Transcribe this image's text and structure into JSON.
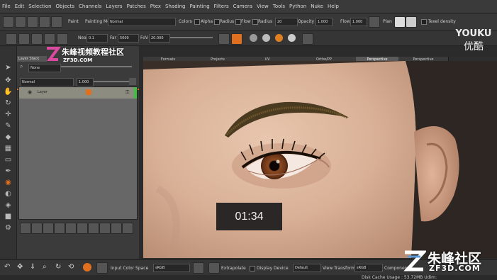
{
  "menu": [
    "File",
    "Edit",
    "Selection",
    "Objects",
    "Channels",
    "Layers",
    "Patches",
    "Ptex",
    "Shading",
    "Painting",
    "Filters",
    "Camera",
    "View",
    "Tools",
    "Python",
    "Nuke",
    "Help"
  ],
  "toolbar1": {
    "paint_label": "Paint",
    "painting_mode_label": "Painting Mode",
    "painting_mode_value": "Normal",
    "colors_label": "Colors",
    "alpha_label": "Alpha",
    "radius_label": "Radius",
    "flow_label": "Flow",
    "radius2_label": "Radius",
    "radius_value": "20",
    "opacity_label": "Opacity",
    "opacity_value": "1.000",
    "flow2_label": "Flow",
    "flow_value": "1.000",
    "plan_label": "Plan",
    "texel_density_label": "Texel density"
  },
  "toolbar2": {
    "near_label": "Near",
    "near_value": "0.1",
    "far_label": "Far",
    "far_value": "5000",
    "fov_label": "FoV",
    "fov_value": "20.000"
  },
  "layers_panel": {
    "tab_label": "Layer Stack",
    "search_value": "None",
    "blend_mode": "Normal",
    "opacity_value": "1.000",
    "layer_name": "Layer"
  },
  "viewport_tabs": [
    "Formats",
    "Projects",
    "UV",
    "Ortho/PP",
    "Perspective",
    "Perspective"
  ],
  "active_tab_index": 4,
  "timer": "01:34",
  "bottombar": {
    "input_color_space_label": "Input Color Space",
    "input_color_space_value": "sRGB",
    "extrapolate_label": "Extrapolate",
    "display_device_label": "Display Device",
    "display_device_value": "Default",
    "view_transform_label": "View Transform",
    "view_transform_value": "sRGB",
    "component_label": "Component"
  },
  "status": "Disk Cache Usage : 53.72MB  Udim:",
  "watermark_top": {
    "cn": "朱峰视频教程社区",
    "url": "ZF3D.COM"
  },
  "youku": {
    "en": "YOUKU",
    "cn": "优酷"
  },
  "watermark_bottom": {
    "cn": "朱峰社区",
    "url": "ZF3D.COM"
  },
  "colors": {
    "accent_orange": "#e07020",
    "layer_green": "#40c040",
    "skin": "#d9b39a"
  }
}
